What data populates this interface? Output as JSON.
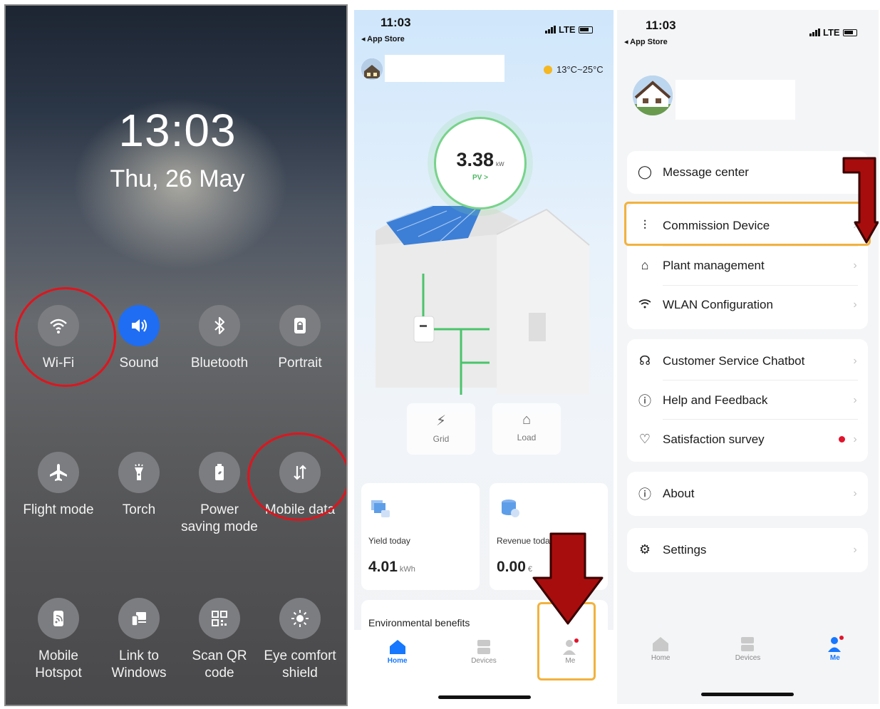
{
  "quick_settings": {
    "time": "13:03",
    "date": "Thu, 26 May",
    "tiles": [
      {
        "label": "Wi-Fi",
        "icon": "wifi-icon",
        "active": false
      },
      {
        "label": "Sound",
        "icon": "sound-icon",
        "active": true
      },
      {
        "label": "Bluetooth",
        "icon": "bluetooth-icon",
        "active": false
      },
      {
        "label": "Portrait",
        "icon": "portrait-lock-icon",
        "active": false
      },
      {
        "label": "Flight mode",
        "icon": "airplane-icon",
        "active": false
      },
      {
        "label": "Torch",
        "icon": "torch-icon",
        "active": false
      },
      {
        "label": "Power saving mode",
        "icon": "battery-saver-icon",
        "active": false
      },
      {
        "label": "Mobile data",
        "icon": "mobile-data-icon",
        "active": false
      },
      {
        "label": "Mobile Hotspot",
        "icon": "hotspot-icon",
        "active": false
      },
      {
        "label": "Link to Windows",
        "icon": "link-windows-icon",
        "active": false
      },
      {
        "label": "Scan QR code",
        "icon": "qr-code-icon",
        "active": false
      },
      {
        "label": "Eye comfort shield",
        "icon": "eye-comfort-icon",
        "active": false
      }
    ],
    "highlight_color": "#e0141c"
  },
  "home_screen": {
    "status_time": "11:03",
    "back_label": "◂ App Store",
    "network": "LTE",
    "weather": "13°C~25°C",
    "power_value": "3.38",
    "power_unit": "kW",
    "power_source": "PV >",
    "grid_label": "Grid",
    "load_label": "Load",
    "yield_label": "Yield today",
    "yield_value": "4.01",
    "yield_unit": "kWh",
    "revenue_label": "Revenue today",
    "revenue_value": "0.00",
    "revenue_unit": "€",
    "env_label": "Environmental benefits",
    "nav": [
      {
        "label": "Home",
        "icon": "home-icon",
        "active": true
      },
      {
        "label": "Devices",
        "icon": "devices-icon",
        "active": false
      },
      {
        "label": "Me",
        "icon": "user-icon",
        "active": false
      }
    ]
  },
  "me_screen": {
    "status_time": "11:03",
    "back_label": "◂ App Store",
    "network": "LTE",
    "menu_groups": [
      [
        {
          "label": "Message center",
          "icon": "message-icon"
        }
      ],
      [
        {
          "label": "Commission Device",
          "icon": "sliders-icon"
        },
        {
          "label": "Plant management",
          "icon": "plant-house-icon"
        },
        {
          "label": "WLAN Configuration",
          "icon": "wifi-icon"
        }
      ],
      [
        {
          "label": "Customer Service Chatbot",
          "icon": "headset-icon"
        },
        {
          "label": "Help and Feedback",
          "icon": "help-icon"
        },
        {
          "label": "Satisfaction survey",
          "icon": "heart-icon"
        }
      ],
      [
        {
          "label": "About",
          "icon": "info-icon"
        }
      ],
      [
        {
          "label": "Settings",
          "icon": "settings-icon"
        }
      ]
    ],
    "nav": [
      {
        "label": "Home",
        "icon": "home-icon",
        "active": false
      },
      {
        "label": "Devices",
        "icon": "devices-icon",
        "active": false
      },
      {
        "label": "Me",
        "icon": "user-icon",
        "active": true
      }
    ]
  },
  "colors": {
    "accent_blue": "#1677ff",
    "highlight_orange": "#f2b23e",
    "arrow_red": "#a80d0d",
    "circle_red": "#e0141c",
    "badge_red": "#e0142c"
  }
}
